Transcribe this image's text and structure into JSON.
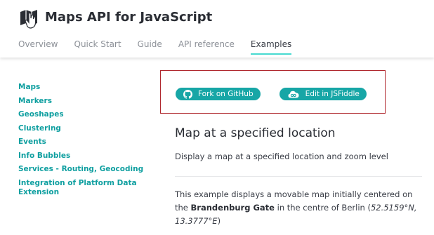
{
  "header": {
    "app_title": "Maps API for JavaScript",
    "logo_icon": "map-hand-icon",
    "nav": [
      {
        "label": "Overview",
        "active": false
      },
      {
        "label": "Quick Start",
        "active": false
      },
      {
        "label": "Guide",
        "active": false
      },
      {
        "label": "API reference",
        "active": false
      },
      {
        "label": "Examples",
        "active": true
      }
    ]
  },
  "sidebar": {
    "items": [
      {
        "label": "Maps"
      },
      {
        "label": "Markers"
      },
      {
        "label": "Geoshapes"
      },
      {
        "label": "Clustering"
      },
      {
        "label": "Events"
      },
      {
        "label": "Info Bubbles"
      },
      {
        "label": "Services - Routing, Geocoding"
      },
      {
        "label": "Integration of Platform Data Extension"
      }
    ]
  },
  "main": {
    "buttons": {
      "github_label": "Fork on GitHub",
      "github_icon": "github-icon",
      "jsfiddle_label": "Edit in JSFiddle",
      "jsfiddle_icon": "cloud-icon"
    },
    "title": "Map at a specified location",
    "subtitle": "Display a map at a specified location and zoom level",
    "description": {
      "part1": "This example displays a movable map initially centered on the ",
      "landmark": "Brandenburg Gate",
      "part2": " in the centre of Berlin (",
      "coords": "52.5159°N, 13.3777°E",
      "part3": ")"
    }
  },
  "colors": {
    "accent": "#17a6a6",
    "link": "#0f9fa0",
    "active_underline": "#48dad0",
    "highlight_border": "#b0282e"
  }
}
